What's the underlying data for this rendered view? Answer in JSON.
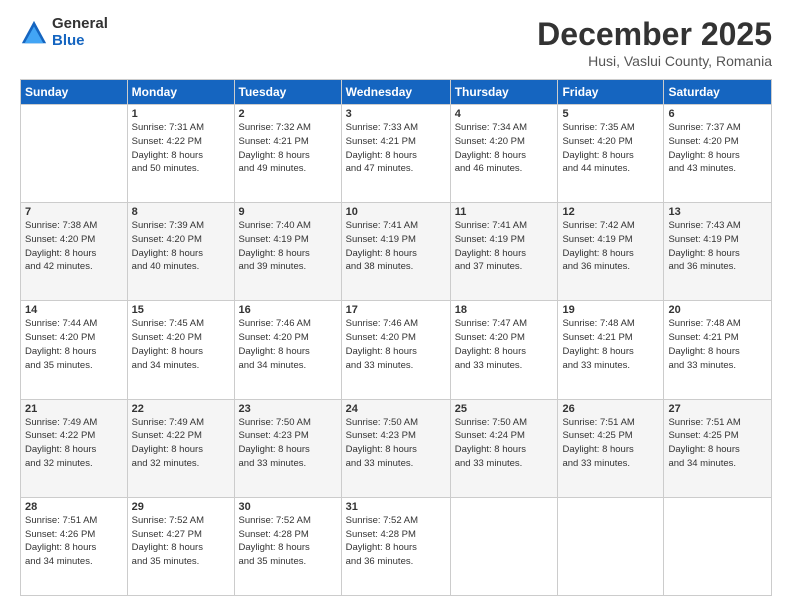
{
  "logo": {
    "general": "General",
    "blue": "Blue"
  },
  "title": "December 2025",
  "subtitle": "Husi, Vaslui County, Romania",
  "headers": [
    "Sunday",
    "Monday",
    "Tuesday",
    "Wednesday",
    "Thursday",
    "Friday",
    "Saturday"
  ],
  "weeks": [
    [
      {
        "day": "",
        "info": ""
      },
      {
        "day": "1",
        "info": "Sunrise: 7:31 AM\nSunset: 4:22 PM\nDaylight: 8 hours\nand 50 minutes."
      },
      {
        "day": "2",
        "info": "Sunrise: 7:32 AM\nSunset: 4:21 PM\nDaylight: 8 hours\nand 49 minutes."
      },
      {
        "day": "3",
        "info": "Sunrise: 7:33 AM\nSunset: 4:21 PM\nDaylight: 8 hours\nand 47 minutes."
      },
      {
        "day": "4",
        "info": "Sunrise: 7:34 AM\nSunset: 4:20 PM\nDaylight: 8 hours\nand 46 minutes."
      },
      {
        "day": "5",
        "info": "Sunrise: 7:35 AM\nSunset: 4:20 PM\nDaylight: 8 hours\nand 44 minutes."
      },
      {
        "day": "6",
        "info": "Sunrise: 7:37 AM\nSunset: 4:20 PM\nDaylight: 8 hours\nand 43 minutes."
      }
    ],
    [
      {
        "day": "7",
        "info": "Sunrise: 7:38 AM\nSunset: 4:20 PM\nDaylight: 8 hours\nand 42 minutes."
      },
      {
        "day": "8",
        "info": "Sunrise: 7:39 AM\nSunset: 4:20 PM\nDaylight: 8 hours\nand 40 minutes."
      },
      {
        "day": "9",
        "info": "Sunrise: 7:40 AM\nSunset: 4:19 PM\nDaylight: 8 hours\nand 39 minutes."
      },
      {
        "day": "10",
        "info": "Sunrise: 7:41 AM\nSunset: 4:19 PM\nDaylight: 8 hours\nand 38 minutes."
      },
      {
        "day": "11",
        "info": "Sunrise: 7:41 AM\nSunset: 4:19 PM\nDaylight: 8 hours\nand 37 minutes."
      },
      {
        "day": "12",
        "info": "Sunrise: 7:42 AM\nSunset: 4:19 PM\nDaylight: 8 hours\nand 36 minutes."
      },
      {
        "day": "13",
        "info": "Sunrise: 7:43 AM\nSunset: 4:19 PM\nDaylight: 8 hours\nand 36 minutes."
      }
    ],
    [
      {
        "day": "14",
        "info": "Sunrise: 7:44 AM\nSunset: 4:20 PM\nDaylight: 8 hours\nand 35 minutes."
      },
      {
        "day": "15",
        "info": "Sunrise: 7:45 AM\nSunset: 4:20 PM\nDaylight: 8 hours\nand 34 minutes."
      },
      {
        "day": "16",
        "info": "Sunrise: 7:46 AM\nSunset: 4:20 PM\nDaylight: 8 hours\nand 34 minutes."
      },
      {
        "day": "17",
        "info": "Sunrise: 7:46 AM\nSunset: 4:20 PM\nDaylight: 8 hours\nand 33 minutes."
      },
      {
        "day": "18",
        "info": "Sunrise: 7:47 AM\nSunset: 4:20 PM\nDaylight: 8 hours\nand 33 minutes."
      },
      {
        "day": "19",
        "info": "Sunrise: 7:48 AM\nSunset: 4:21 PM\nDaylight: 8 hours\nand 33 minutes."
      },
      {
        "day": "20",
        "info": "Sunrise: 7:48 AM\nSunset: 4:21 PM\nDaylight: 8 hours\nand 33 minutes."
      }
    ],
    [
      {
        "day": "21",
        "info": "Sunrise: 7:49 AM\nSunset: 4:22 PM\nDaylight: 8 hours\nand 32 minutes."
      },
      {
        "day": "22",
        "info": "Sunrise: 7:49 AM\nSunset: 4:22 PM\nDaylight: 8 hours\nand 32 minutes."
      },
      {
        "day": "23",
        "info": "Sunrise: 7:50 AM\nSunset: 4:23 PM\nDaylight: 8 hours\nand 33 minutes."
      },
      {
        "day": "24",
        "info": "Sunrise: 7:50 AM\nSunset: 4:23 PM\nDaylight: 8 hours\nand 33 minutes."
      },
      {
        "day": "25",
        "info": "Sunrise: 7:50 AM\nSunset: 4:24 PM\nDaylight: 8 hours\nand 33 minutes."
      },
      {
        "day": "26",
        "info": "Sunrise: 7:51 AM\nSunset: 4:25 PM\nDaylight: 8 hours\nand 33 minutes."
      },
      {
        "day": "27",
        "info": "Sunrise: 7:51 AM\nSunset: 4:25 PM\nDaylight: 8 hours\nand 34 minutes."
      }
    ],
    [
      {
        "day": "28",
        "info": "Sunrise: 7:51 AM\nSunset: 4:26 PM\nDaylight: 8 hours\nand 34 minutes."
      },
      {
        "day": "29",
        "info": "Sunrise: 7:52 AM\nSunset: 4:27 PM\nDaylight: 8 hours\nand 35 minutes."
      },
      {
        "day": "30",
        "info": "Sunrise: 7:52 AM\nSunset: 4:28 PM\nDaylight: 8 hours\nand 35 minutes."
      },
      {
        "day": "31",
        "info": "Sunrise: 7:52 AM\nSunset: 4:28 PM\nDaylight: 8 hours\nand 36 minutes."
      },
      {
        "day": "",
        "info": ""
      },
      {
        "day": "",
        "info": ""
      },
      {
        "day": "",
        "info": ""
      }
    ]
  ]
}
